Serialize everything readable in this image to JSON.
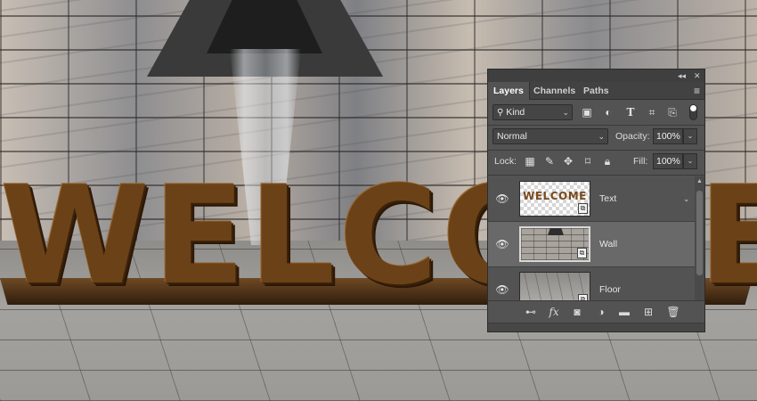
{
  "scene": {
    "sign_text": "WELCOME"
  },
  "panel": {
    "topbar": {
      "collapse_icon": "double-chevron",
      "close_icon": "close"
    },
    "tabs": [
      {
        "label": "Layers",
        "active": true
      },
      {
        "label": "Channels",
        "active": false
      },
      {
        "label": "Paths",
        "active": false
      }
    ],
    "filter": {
      "kind_label": "Kind",
      "filter_icons": [
        "image-filter",
        "adjustment-filter",
        "type-filter",
        "shape-filter",
        "smart-object-filter"
      ]
    },
    "blend": {
      "mode": "Normal",
      "opacity_label": "Opacity:",
      "opacity_value": "100%"
    },
    "lock": {
      "label": "Lock:",
      "fill_label": "Fill:",
      "fill_value": "100%"
    },
    "layers": [
      {
        "name": "Text",
        "thumb_text": "WELCOME",
        "selected": false,
        "visible": true,
        "type": "smart-object"
      },
      {
        "name": "Wall",
        "selected": true,
        "visible": true,
        "type": "smart-object"
      },
      {
        "name": "Floor",
        "selected": false,
        "visible": true,
        "type": "smart-object"
      }
    ]
  }
}
